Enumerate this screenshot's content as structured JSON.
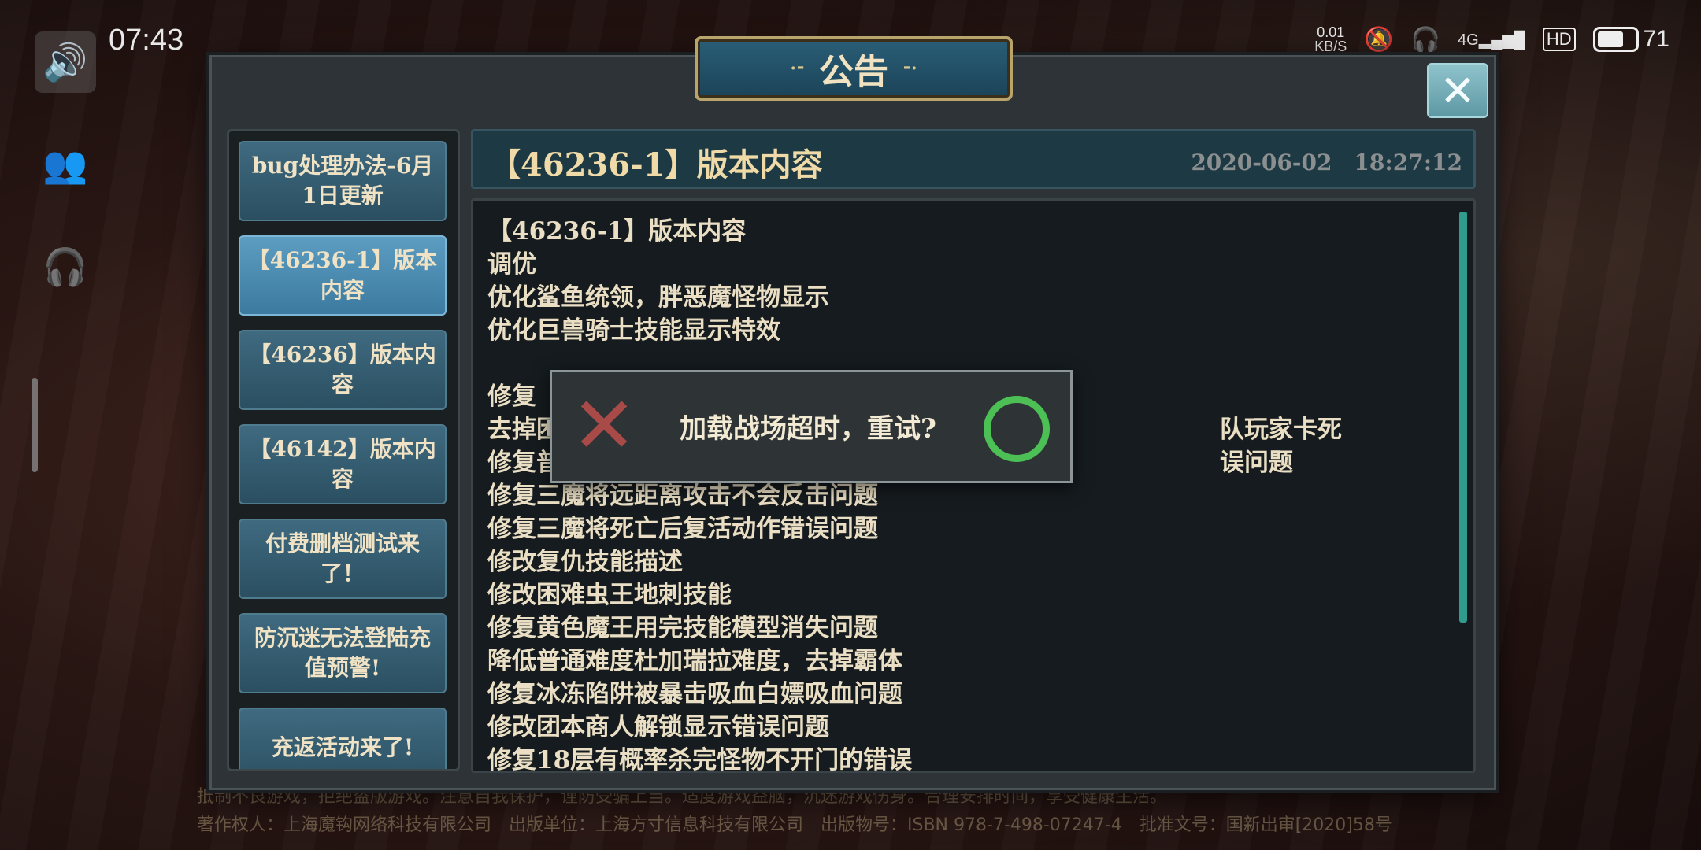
{
  "status_bar": {
    "time": "07:43",
    "net_speed_value": "0.01",
    "net_speed_unit": "KB/S",
    "network": "4G",
    "hd": "HD",
    "battery_level": "71",
    "battery_fraction": 0.71
  },
  "left_tools": {
    "speaker_icon": "speaker-icon",
    "friends_icon": "friends-icon",
    "support_icon": "support-icon"
  },
  "panel": {
    "title": "公告",
    "title_deco_left": "·⁃",
    "title_deco_right": "⁃·",
    "close_glyph": "✕"
  },
  "announcements": [
    {
      "label": "bug处理办法-6月1日更新",
      "active": false
    },
    {
      "label": "【46236-1】版本内容",
      "active": true
    },
    {
      "label": "【46236】版本内容",
      "active": false
    },
    {
      "label": "【46142】版本内容",
      "active": false
    },
    {
      "label": "付费删档测试来了！",
      "active": false
    },
    {
      "label": "防沉迷无法登陆充值预警!",
      "active": false
    },
    {
      "label": "充返活动来了!",
      "active": false
    }
  ],
  "content": {
    "title": "【46236-1】版本内容",
    "date": "2020-06-02　18:27:12",
    "lines": [
      "【46236-1】版本内容",
      "调优",
      "优化鲨鱼统领，胖恶魔怪物显示",
      "优化巨兽骑士技能显示特效",
      "",
      "修复",
      "去掉困　　　　　　　　　　　　　　　　　　　　　　　　　　　队玩家卡死",
      "修复普　　　　　　　　　　　　　　　　　　　　　　　　　　　误问题",
      "修复三魔将远距离攻击不会反击问题",
      "修复三魔将死亡后复活动作错误问题",
      "修改复仇技能描述",
      "修改困难虫王地刺技能",
      "修复黄色魔王用完技能模型消失问题",
      "降低普通难度杜加瑞拉难度，去掉霸体",
      "修复冰冻陷阱被暴击吸血白嫖吸血问题",
      "修改团本商人解锁显示错误问题",
      "修复18层有概率杀完怪物不开门的错误"
    ]
  },
  "dialog": {
    "message": "加载战场超时，重试?",
    "cancel_glyph": "✕",
    "cancel_color": "#a84a48",
    "confirm_color": "#4cbf55"
  },
  "footer": {
    "line1": "抵制不良游戏，拒绝盗版游戏。注意自我保护，谨防受骗上当。适度游戏益脑，沉迷游戏伤身。合理安排时间，享受健康生活。",
    "line2": "著作权人：上海魔钩网络科技有限公司　出版单位：上海方寸信息科技有限公司　出版物号：ISBN 978-7-498-07247-4　批准文号：国新出审[2020]58号"
  }
}
